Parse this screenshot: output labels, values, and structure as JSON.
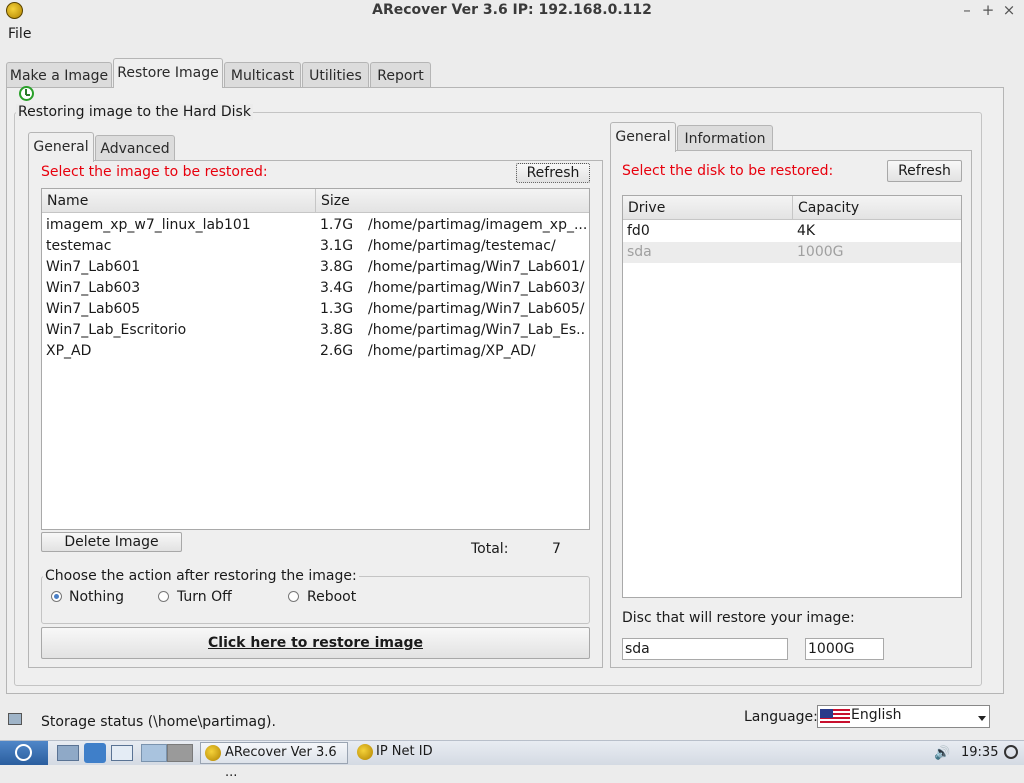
{
  "window": {
    "title": "ARecover Ver 3.6 IP: 192.168.0.112",
    "controls": {
      "minimize": "–",
      "maximize": "+",
      "close": "×"
    }
  },
  "menu": {
    "file": "File"
  },
  "main_tabs": [
    {
      "label": "Make a Image",
      "active": false
    },
    {
      "label": "Restore Image",
      "active": true
    },
    {
      "label": "Multicast",
      "active": false
    },
    {
      "label": "Utilities",
      "active": false
    },
    {
      "label": "Report",
      "active": false
    }
  ],
  "restore": {
    "group_title": "Restoring image to the Hard Disk",
    "left": {
      "tabs": [
        {
          "label": "General",
          "active": true
        },
        {
          "label": "Advanced",
          "active": false
        }
      ],
      "prompt": "Select the image to be restored:",
      "refresh_label": "Refresh",
      "columns": [
        "Name",
        "Size"
      ],
      "rows": [
        {
          "name": "imagem_xp_w7_linux_lab101",
          "size": "1.7G",
          "path": "/home/partimag/imagem_xp_..."
        },
        {
          "name": "testemac",
          "size": "3.1G",
          "path": "/home/partimag/testemac/"
        },
        {
          "name": "Win7_Lab601",
          "size": "3.8G",
          "path": "/home/partimag/Win7_Lab601/"
        },
        {
          "name": "Win7_Lab603",
          "size": "3.4G",
          "path": "/home/partimag/Win7_Lab603/"
        },
        {
          "name": "Win7_Lab605",
          "size": "1.3G",
          "path": "/home/partimag/Win7_Lab605/"
        },
        {
          "name": "Win7_Lab_Escritorio",
          "size": "3.8G",
          "path": "/home/partimag/Win7_Lab_Es..."
        },
        {
          "name": "XP_AD",
          "size": "2.6G",
          "path": "/home/partimag/XP_AD/"
        }
      ],
      "delete_label": "Delete Image",
      "total_label": "Total:",
      "total_value": "7",
      "action_title": "Choose the action after restoring the image:",
      "actions": [
        {
          "label": "Nothing",
          "selected": true
        },
        {
          "label": "Turn Off",
          "selected": false
        },
        {
          "label": "Reboot",
          "selected": false
        }
      ],
      "restore_button": "Click here to restore image"
    },
    "right": {
      "tabs": [
        {
          "label": "General",
          "active": true
        },
        {
          "label": "Information",
          "active": false
        }
      ],
      "prompt": "Select the disk to be restored:",
      "refresh_label": "Refresh",
      "columns": [
        "Drive",
        "Capacity"
      ],
      "rows": [
        {
          "drive": "fd0",
          "capacity": "4K",
          "disabled": false
        },
        {
          "drive": "sda",
          "capacity": "1000G",
          "disabled": true
        }
      ],
      "disc_label": "Disc that will restore your image:",
      "disc_value": "sda",
      "capacity_value": "1000G"
    }
  },
  "status": {
    "storage_text": "Storage status (\\home\\partimag).",
    "language_label": "Language:",
    "language_value": "English"
  },
  "taskbar": {
    "app1": "ARecover Ver 3.6 ...",
    "app2": "IP Net ID",
    "clock": "19:35"
  },
  "colors": {
    "accent_red": "#e8000d",
    "selection_blue": "#4a7fc6"
  },
  "icons": [
    "app-logo-icon",
    "restore-icon",
    "storage-icon",
    "us-flag-icon",
    "start-menu-icon",
    "volume-icon",
    "power-icon"
  ]
}
